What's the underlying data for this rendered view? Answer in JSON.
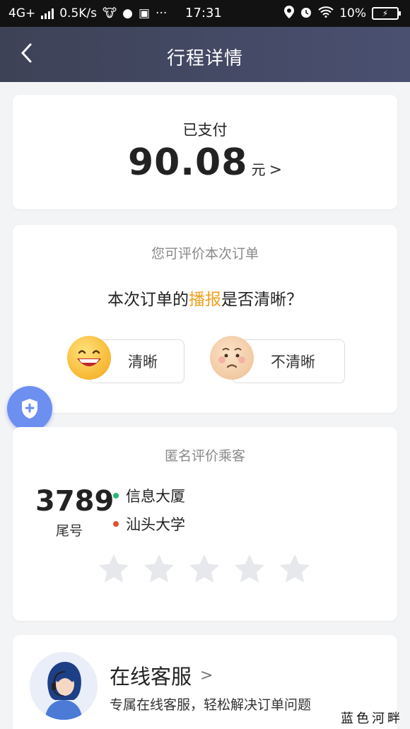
{
  "status_bar": {
    "network": "4G+",
    "speed": "0.5K/s",
    "time": "17:31",
    "battery": "10%"
  },
  "nav": {
    "back_icon": "chevron-left-icon",
    "title": "行程详情"
  },
  "payment": {
    "label": "已支付",
    "amount": "90.08",
    "unit": "元",
    "arrow": ">"
  },
  "rating": {
    "subtitle": "您可评价本次订单",
    "question_prefix": "本次订单的",
    "question_highlight": "播报",
    "question_suffix": "是否清晰？",
    "highlight_color": "#f0a020",
    "option_clear": "清晰",
    "option_unclear": "不清晰"
  },
  "anonymous": {
    "title": "匿名评价乘客",
    "tail_number": "3789",
    "tail_label": "尾号",
    "start_place": "信息大厦",
    "end_place": "汕头大学",
    "start_color": "#2bb673",
    "end_color": "#e0532f",
    "star_count": 5,
    "stars_selected": 0
  },
  "customer_service": {
    "title": "在线客服",
    "chevron": ">",
    "description": "专属在线客服，轻松解决订单问题"
  },
  "watermark": "蓝色河畔"
}
